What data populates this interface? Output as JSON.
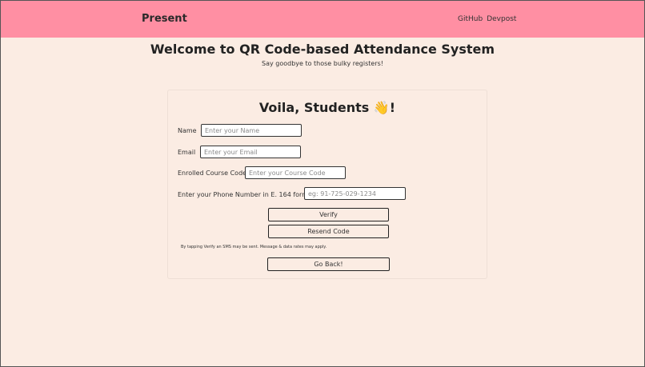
{
  "navbar": {
    "brand": "Present",
    "links": [
      "GitHub",
      "Devpost"
    ]
  },
  "header": {
    "title": "Welcome to QR Code-based Attendance System",
    "subtitle": "Say goodbye to those bulky registers!"
  },
  "card": {
    "title": "Voila, Students",
    "emoji": "👋",
    "title_suffix": "!"
  },
  "form": {
    "name": {
      "label": "Name",
      "placeholder": "Enter your Name",
      "value": ""
    },
    "email": {
      "label": "Email",
      "placeholder": "Enter your Email",
      "value": ""
    },
    "course": {
      "label": "Enrolled Course Code",
      "placeholder": "Enter your Course Code",
      "value": ""
    },
    "phone": {
      "label": "Enter your Phone Number in E. 164 format",
      "placeholder": "eg: 91-725-029-1234",
      "value": ""
    }
  },
  "buttons": {
    "verify": "Verify",
    "resend": "Resend Code",
    "back": "Go Back!"
  },
  "disclaimer": "By tapping Verify an SMS may be sent. Message & data rates may apply.",
  "colors": {
    "navbar_bg": "#ff8fa3",
    "page_bg": "#fbece3"
  }
}
